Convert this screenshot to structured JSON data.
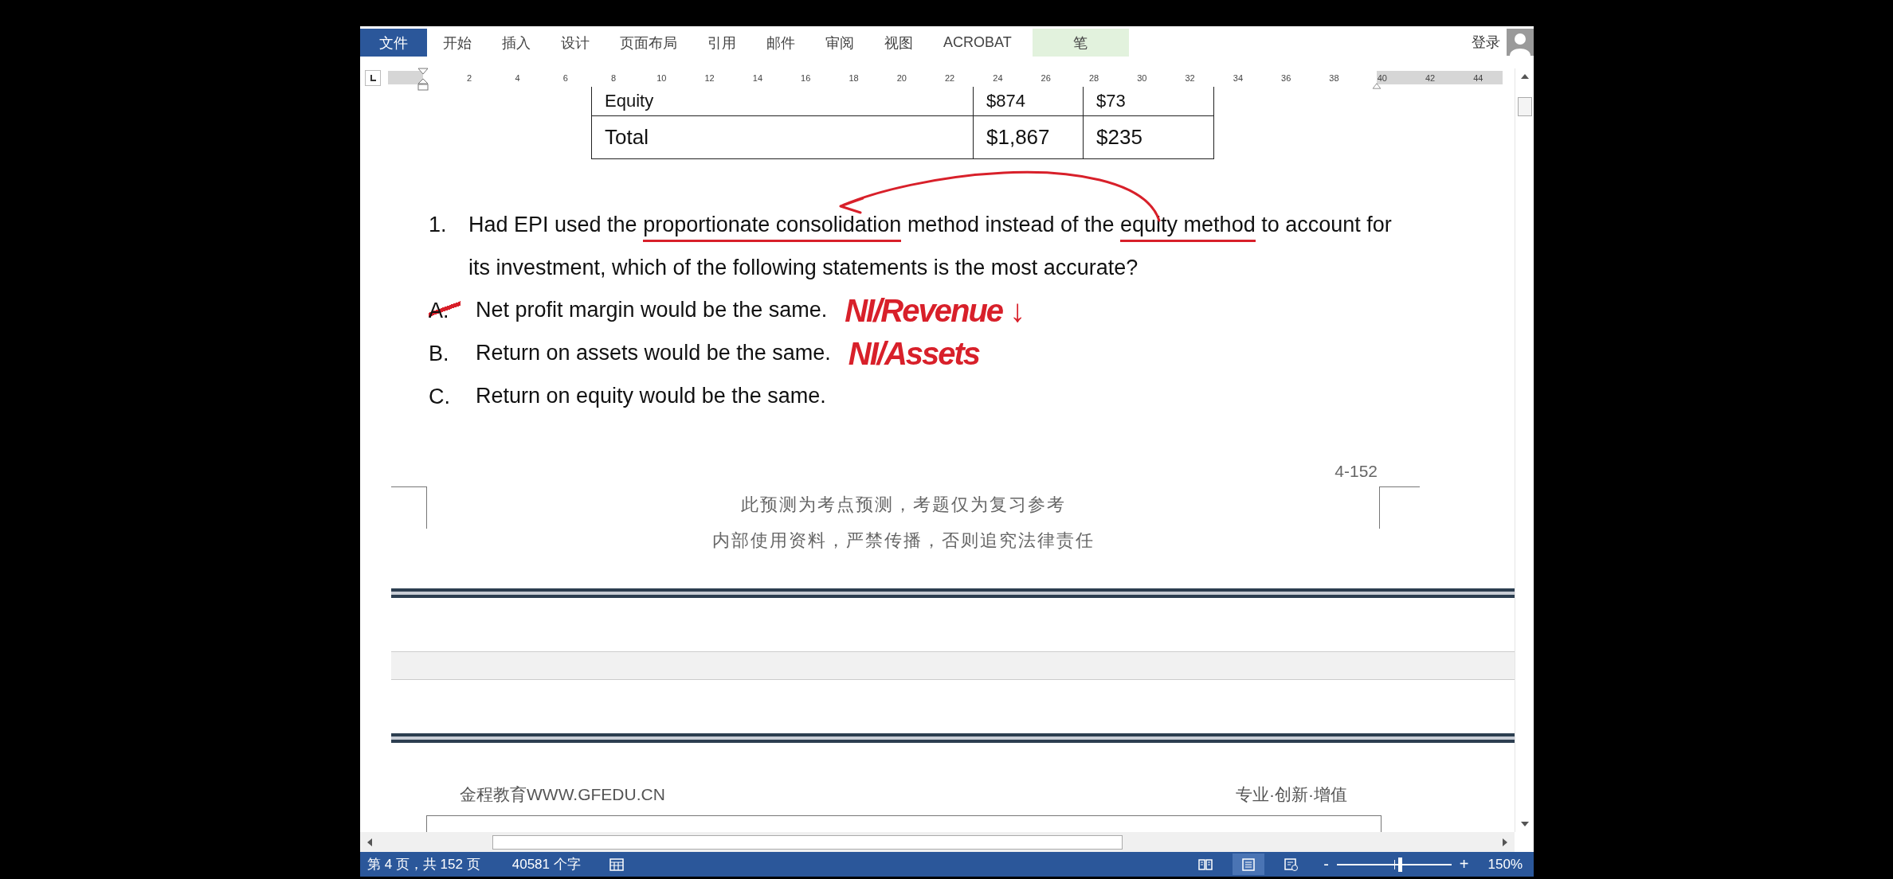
{
  "ribbon": {
    "tabs": [
      {
        "label": "文件",
        "kind": "file",
        "selected": false
      },
      {
        "label": "开始",
        "kind": "normal",
        "selected": false
      },
      {
        "label": "插入",
        "kind": "normal",
        "selected": false
      },
      {
        "label": "设计",
        "kind": "normal",
        "selected": false
      },
      {
        "label": "页面布局",
        "kind": "normal",
        "selected": false
      },
      {
        "label": "引用",
        "kind": "normal",
        "selected": false
      },
      {
        "label": "邮件",
        "kind": "normal",
        "selected": false
      },
      {
        "label": "审阅",
        "kind": "normal",
        "selected": false
      },
      {
        "label": "视图",
        "kind": "normal",
        "selected": false
      },
      {
        "label": "ACROBAT",
        "kind": "normal",
        "selected": false
      },
      {
        "label": "笔",
        "kind": "contextual",
        "selected": false
      }
    ],
    "sign_in": "登录"
  },
  "ruler": {
    "labels": [
      "2",
      "4",
      "6",
      "8",
      "10",
      "12",
      "14",
      "16",
      "18",
      "20",
      "22",
      "24",
      "26",
      "28",
      "30",
      "32",
      "34",
      "36",
      "38",
      "40",
      "42",
      "44"
    ]
  },
  "table": {
    "rows": [
      {
        "cells": [
          "Equity",
          "$874",
          "$73"
        ]
      },
      {
        "cells": [
          "Total",
          "$1,867",
          "$235"
        ]
      }
    ]
  },
  "question": {
    "number": "1.",
    "segments": [
      {
        "text": "Had EPI used the "
      },
      {
        "text": "proportionate consolidation",
        "ink_underline": true
      },
      {
        "text": " method instead of the "
      },
      {
        "text": "equity method",
        "ink_underline": true
      },
      {
        "text": " to account for its investment, which of the following statements is the most accurate?"
      }
    ]
  },
  "options": [
    {
      "letter": "A.",
      "text": "Net profit margin would be the same.",
      "crossed_out": true,
      "note": "NI/Revenue ↓"
    },
    {
      "letter": "B.",
      "text": "Return on assets would be the same.",
      "crossed_out": false,
      "note": "NI/Assets"
    },
    {
      "letter": "C.",
      "text": "Return on equity would be the same.",
      "crossed_out": false
    }
  ],
  "page_footer": {
    "page_number": "4-152",
    "notice_lines": [
      "此预测为考点预测，考题仅为复习参考",
      "内部使用资料，严禁传播，否则追究法律责任"
    ]
  },
  "next_page_header": {
    "left": "金程教育WWW.GFEDU.CN",
    "right": "专业·创新·增值"
  },
  "status_bar": {
    "page": "第 4 页，共 152 页",
    "words": "40581 个字",
    "views": [
      {
        "kind": "read",
        "selected": false
      },
      {
        "kind": "print",
        "selected": true
      },
      {
        "kind": "web",
        "selected": false
      }
    ],
    "zoom_out": "-",
    "zoom_slider": {
      "level": 0.56
    },
    "zoom_in": "+",
    "zoom": "150%"
  }
}
